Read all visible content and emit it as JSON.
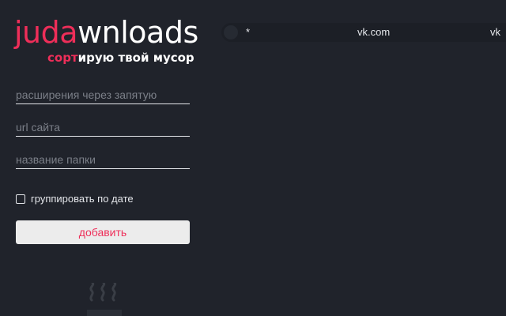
{
  "logo": {
    "accent": "juda",
    "rest": "wnloads"
  },
  "tagline": {
    "accent": "сорт",
    "rest": "ирую твой мусор"
  },
  "form": {
    "extensions_placeholder": "расширения через запятую",
    "url_placeholder": "url сайта",
    "folder_placeholder": "название папки",
    "group_by_date_label": "группировать по дате",
    "group_by_date_checked": false,
    "add_button_label": "добавить"
  },
  "rules": [
    {
      "extensions": "*",
      "url": "vk.com",
      "folder": "vk"
    }
  ],
  "colors": {
    "background": "#20232b",
    "accent": "#ee2e59",
    "button_bg": "#ececec",
    "row_bg": "#1c1f26"
  },
  "icons": {
    "rule_toggle": "circle-dot-icon",
    "empty_state": "steam-cup-icon"
  }
}
